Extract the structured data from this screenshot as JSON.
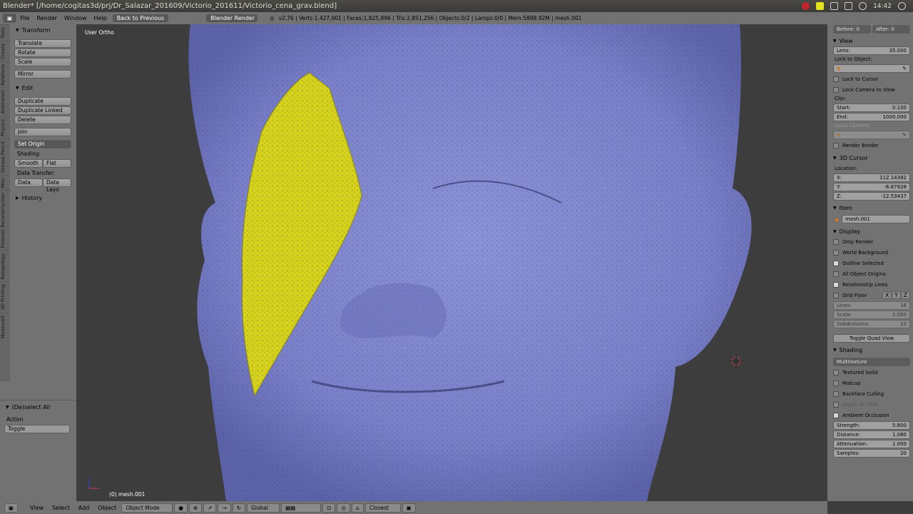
{
  "window": {
    "title": "Blender* [/home/cogitas3d/prj/Dr_Salazar_201609/Victorio_201611/Victorio_cena_grav.blend]"
  },
  "tray": {
    "time": "14:42"
  },
  "info_header": {
    "menus": [
      "File",
      "Render",
      "Window",
      "Help"
    ],
    "back_button": "Back to Previous",
    "engine": "Blender Render",
    "stats": "v2.76 | Verts:1,427,901 | Faces:1,825,896 | Tris:2,851,256 | Objects:0/2 | Lamps:0/0 | Mem:5898.92M | mesh.001"
  },
  "tool_tabs": [
    "Tools",
    "Create",
    "Relations",
    "Animation",
    "Physics",
    "Grease Pencil",
    "Misc",
    "Forensic Reconstruction",
    "Retopology",
    "3D Printing",
    "Measureit"
  ],
  "tool_shelf": {
    "transform": {
      "title": "Transform",
      "buttons": [
        "Translate",
        "Rotate",
        "Scale",
        "Mirror"
      ]
    },
    "edit": {
      "title": "Edit",
      "buttons": [
        "Duplicate",
        "Duplicate Linked",
        "Delete",
        "Join"
      ],
      "set_origin": "Set Origin",
      "shading_label": "Shading:",
      "smooth": "Smooth",
      "flat": "Flat",
      "data_transfer_label": "Data Transfer:",
      "data": "Data",
      "data_layout": "Data Layo"
    },
    "history": {
      "title": "History"
    },
    "operator": {
      "title": "(De)select All",
      "action_label": "Action",
      "action_value": "Toggle"
    }
  },
  "viewport": {
    "view_name": "User Ortho",
    "object_label": "(0) mesh.001"
  },
  "properties": {
    "top_fields": [
      "Before: 0",
      "After: 0"
    ],
    "view": {
      "title": "View",
      "lens_label": "Lens:",
      "lens_value": "35.000",
      "lock_to_object": "Lock to Object:",
      "lock_to_cursor": "Lock to Cursor",
      "lock_camera": "Lock Camera to View",
      "clip": "Clip:",
      "start_label": "Start:",
      "start_value": "0.100",
      "end_label": "End:",
      "end_value": "1000.000",
      "local_camera": "Local Camera:",
      "render_border": "Render Border"
    },
    "cursor": {
      "title": "3D Cursor",
      "location": "Location:",
      "x_label": "X:",
      "x": "112.14392",
      "y_label": "Y:",
      "y": "-6.67928",
      "z_label": "Z:",
      "z": "-12.53437"
    },
    "item": {
      "title": "Item",
      "name": "mesh.001"
    },
    "display": {
      "title": "Display",
      "only_render": "Only Render",
      "world_background": "World Background",
      "outline_selected": "Outline Selected",
      "all_object_origins": "All Object Origins",
      "relationship_lines": "Relationship Lines",
      "grid_floor": "Grid Floor",
      "x": "X",
      "y": "Y",
      "z": "Z",
      "lines_label": "Lines:",
      "lines": "16",
      "scale_label": "Scale:",
      "scale": "1.000",
      "subdivisions_label": "Subdivisions:",
      "subdivisions": "10",
      "toggle_quad": "Toggle Quad View"
    },
    "shading": {
      "title": "Shading",
      "mode": "Multitexture",
      "textured_solid": "Textured Solid",
      "matcap": "Matcap",
      "backface_culling": "Backface Culling",
      "depth_of_field": "Depth Of Field",
      "ambient_occlusion": "Ambient Occlusion",
      "strength_label": "Strength:",
      "strength": "5.800",
      "distance_label": "Distance:",
      "distance": "1.080",
      "attenuation_label": "Attenuation:",
      "attenuation": "1.000",
      "samples_label": "Samples:",
      "samples": "20"
    }
  },
  "header_3d": {
    "menus": [
      "View",
      "Select",
      "Add",
      "Object"
    ],
    "mode": "Object Mode",
    "orientation": "Global",
    "snap": "Closest"
  },
  "colors": {
    "mesh": "#7a80c8",
    "selection": "#d6d21c",
    "panel": "#727272",
    "viewport": "#3d3d3d"
  }
}
